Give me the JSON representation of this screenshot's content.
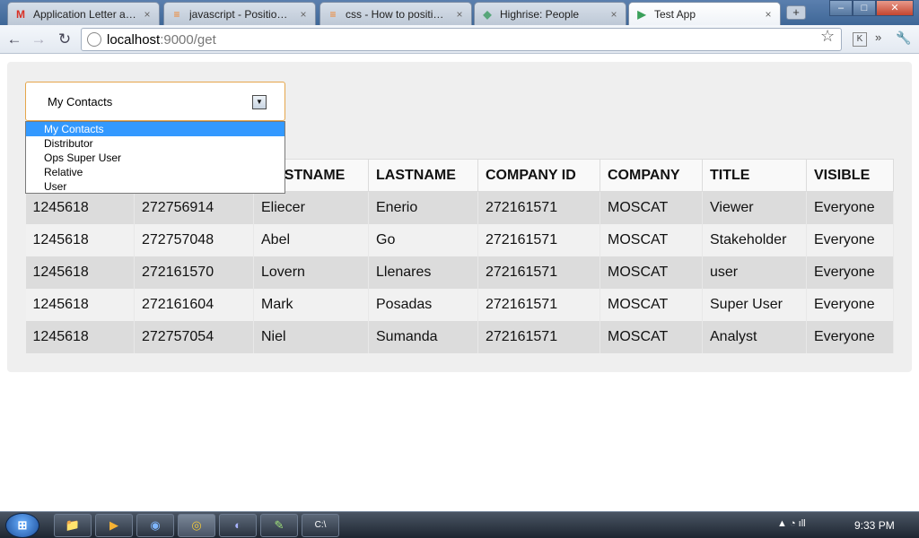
{
  "browser": {
    "tabs": [
      {
        "title": "Application Letter as ...",
        "icon": "gmail-icon",
        "glyph": "M",
        "color": "#d93025"
      },
      {
        "title": "javascript - Positioni...",
        "icon": "stackoverflow-icon",
        "glyph": "≡",
        "color": "#f48024"
      },
      {
        "title": "css - How to position...",
        "icon": "stackoverflow-icon",
        "glyph": "≡",
        "color": "#f48024"
      },
      {
        "title": "Highrise: People",
        "icon": "highrise-icon",
        "glyph": "◆",
        "color": "#58a67a"
      },
      {
        "title": "Test App",
        "icon": "play-icon",
        "glyph": "▶",
        "color": "#3aa05a"
      }
    ],
    "tab_close": "×",
    "new_tab": "+",
    "window_buttons": {
      "minimize": "–",
      "maximize": "□",
      "close": "✕"
    },
    "nav": {
      "back": "←",
      "forward": "→",
      "reload": "↻"
    },
    "url_host": "localhost",
    "url_path": ":9000/get",
    "star": "☆",
    "extensions": {
      "k": "K",
      "more": "»",
      "wrench": "🔧"
    }
  },
  "page": {
    "select": {
      "value": "My Contacts",
      "arrow": "▼",
      "options": [
        "My Contacts",
        "Distributor",
        "Ops Super User",
        "Relative",
        "User"
      ]
    },
    "table": {
      "columns": [
        "",
        "",
        "FIRSTNAME",
        "LASTNAME",
        "COMPANY ID",
        "COMPANY",
        "TITLE",
        "VISIBLE"
      ],
      "rows": [
        [
          "1245618",
          "272756914",
          "Eliecer",
          "Enerio",
          "272161571",
          "MOSCAT",
          "Viewer",
          "Everyone"
        ],
        [
          "1245618",
          "272757048",
          "Abel",
          "Go",
          "272161571",
          "MOSCAT",
          "Stakeholder",
          "Everyone"
        ],
        [
          "1245618",
          "272161570",
          "Lovern",
          "Llenares",
          "272161571",
          "MOSCAT",
          "user",
          "Everyone"
        ],
        [
          "1245618",
          "272161604",
          "Mark",
          "Posadas",
          "272161571",
          "MOSCAT",
          "Super User",
          "Everyone"
        ],
        [
          "1245618",
          "272757054",
          "Niel",
          "Sumanda",
          "272161571",
          "MOSCAT",
          "Analyst",
          "Everyone"
        ]
      ]
    }
  },
  "taskbar": {
    "start": "⊞",
    "apps": [
      {
        "name": "explorer-app",
        "glyph": "📁"
      },
      {
        "name": "media-player-app",
        "glyph": "▶"
      },
      {
        "name": "network-app",
        "glyph": "◉"
      },
      {
        "name": "chrome-app",
        "glyph": "◎"
      },
      {
        "name": "eclipse-app",
        "glyph": "◐"
      },
      {
        "name": "notepad-app",
        "glyph": "✎"
      },
      {
        "name": "cmd-app",
        "glyph": "C:\\"
      }
    ],
    "tray": "▲  ◔  ıll",
    "clock": "9:33 PM"
  },
  "colors": {
    "select_border": "#e5a64b",
    "selected_option": "#3399ff",
    "panel": "#efefef"
  }
}
